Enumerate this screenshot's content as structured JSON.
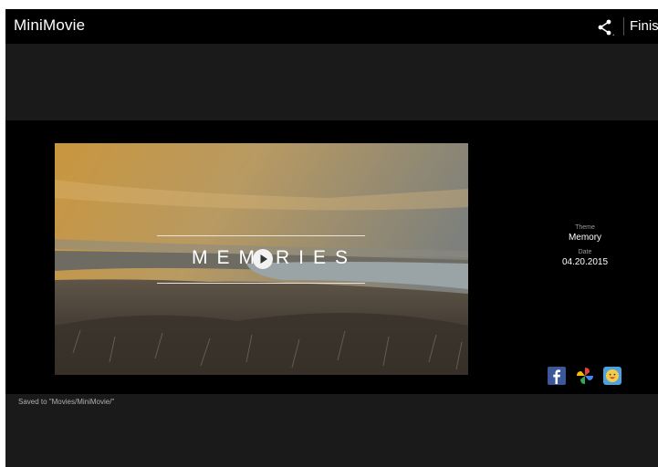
{
  "app": {
    "title": "MiniMovie",
    "finish_label": "Finish"
  },
  "icons": {
    "share": "share-icon",
    "play": "play-icon",
    "facebook": "facebook-icon",
    "pinwheel": "pinwheel-icon",
    "chat": "chat-icon"
  },
  "video": {
    "title_left": "MEM",
    "title_right": "RIES"
  },
  "info": {
    "theme_label": "Theme",
    "theme_value": "Memory",
    "date_label": "Date",
    "date_value": "04.20.2015"
  },
  "status": {
    "saved_text": "Saved to \"Movies/MiniMovie/\""
  },
  "colors": {
    "bar": "#000000",
    "surface": "#1a1a1a",
    "facebook": "#3b5998",
    "chat": "#4aa3df"
  }
}
